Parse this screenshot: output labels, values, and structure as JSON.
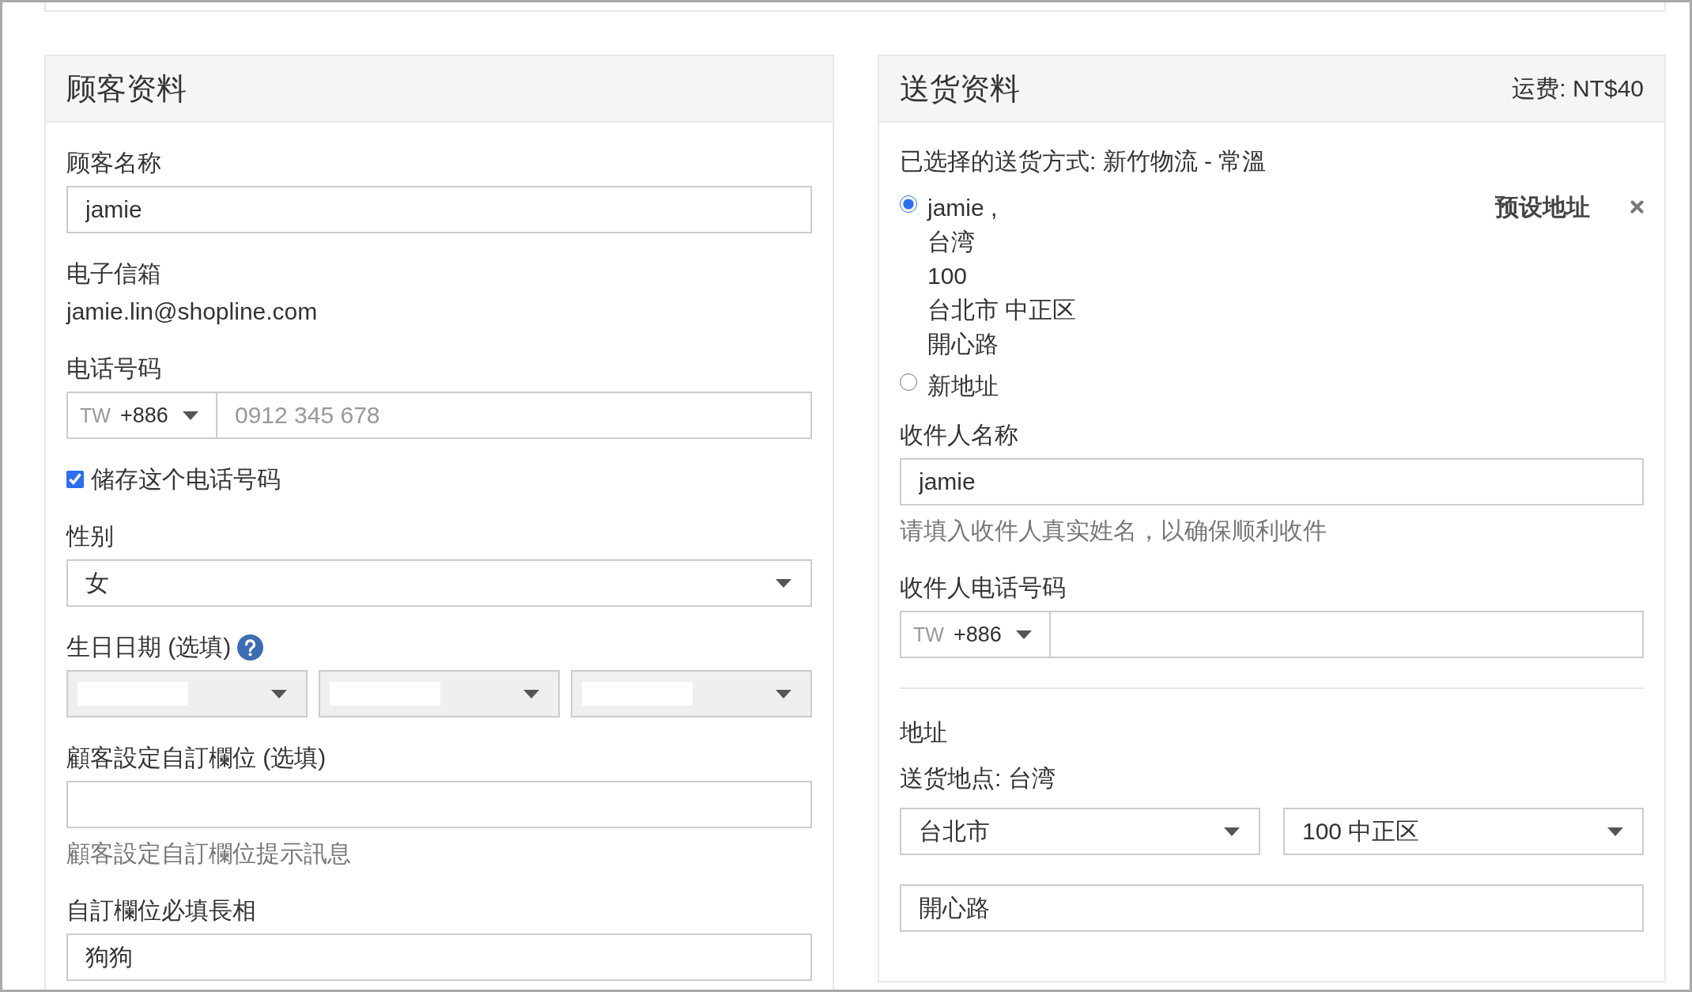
{
  "customer_panel": {
    "title": "顾客资料",
    "fields": [
      {
        "kind": "text",
        "label": "顾客名称",
        "value": "jamie"
      },
      {
        "kind": "static",
        "label": "电子信箱",
        "value": "jamie.lin@shopline.com"
      },
      {
        "kind": "phone",
        "label": "电话号码",
        "country": "TW",
        "code": "+886",
        "placeholder": "0912 345 678"
      },
      {
        "kind": "checkbox",
        "label": "储存这个电话号码",
        "checked": true
      },
      {
        "kind": "select",
        "label": "性别",
        "value": "女"
      },
      {
        "kind": "date",
        "label": "生日日期 (选填)",
        "help": true,
        "selects": [
          {
            "disabled": true
          },
          {
            "disabled": true
          },
          {
            "disabled": true
          }
        ]
      },
      {
        "kind": "text",
        "label": "顧客設定自訂欄位 (选填)",
        "hint": "顧客設定自訂欄位提示訊息"
      },
      {
        "kind": "text",
        "label": "自訂欄位必填長相",
        "value": "狗狗"
      }
    ]
  },
  "delivery_panel": {
    "title": "送货资料",
    "fee": "运费: NT$40",
    "method": "已选择的送货方式: 新竹物流 - 常溫",
    "address_options": [
      {
        "selected": true,
        "lines": [
          "jamie ,",
          "台湾",
          "100",
          "台北市 中正区",
          "開心路"
        ],
        "badge": "预设地址",
        "removable": true
      },
      {
        "selected": false,
        "lines": [
          "新地址"
        ]
      }
    ],
    "fields": [
      {
        "kind": "text",
        "label": "收件人名称",
        "value": "jamie",
        "hint": "请填入收件人真实姓名，以确保顺利收件"
      },
      {
        "kind": "phone",
        "label": "收件人电话号码",
        "country": "TW",
        "code": "+886"
      }
    ],
    "address": {
      "title": "地址",
      "destination": "送货地点: 台湾",
      "city": "台北市",
      "district": "100 中正区",
      "street": "開心路"
    }
  }
}
